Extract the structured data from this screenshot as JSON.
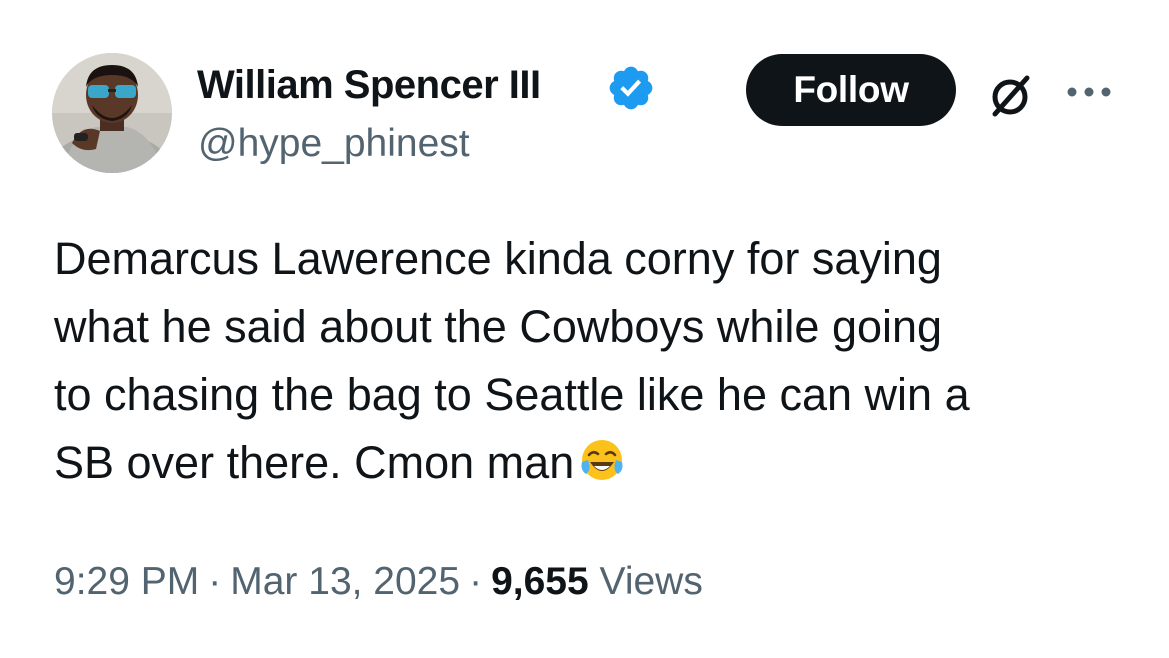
{
  "author": {
    "display_name": "William Spencer III",
    "handle": "@hype_phinest",
    "verified_icon": "verified-badge-icon",
    "avatar_icon": "profile-photo"
  },
  "header_actions": {
    "follow_label": "Follow",
    "grok_icon": "grok-slash-circle-icon",
    "more_icon": "more-dots-icon"
  },
  "tweet": {
    "text_lines": [
      "Demarcus Lawerence kinda corny for saying",
      "what he said about the Cowboys while going",
      "to chasing the bag to Seattle like he can win a",
      "SB over there. Cmon man"
    ],
    "trailing_emoji": "face-with-tears-of-joy-emoji"
  },
  "meta": {
    "time": "9:29 PM",
    "separator": "·",
    "date": "Mar 13, 2025",
    "views_count": "9,655",
    "views_label": "Views"
  },
  "colors": {
    "text_primary": "#0f1419",
    "text_secondary": "#536471",
    "verified_blue": "#1d9bf0",
    "button_bg": "#0f1419"
  }
}
